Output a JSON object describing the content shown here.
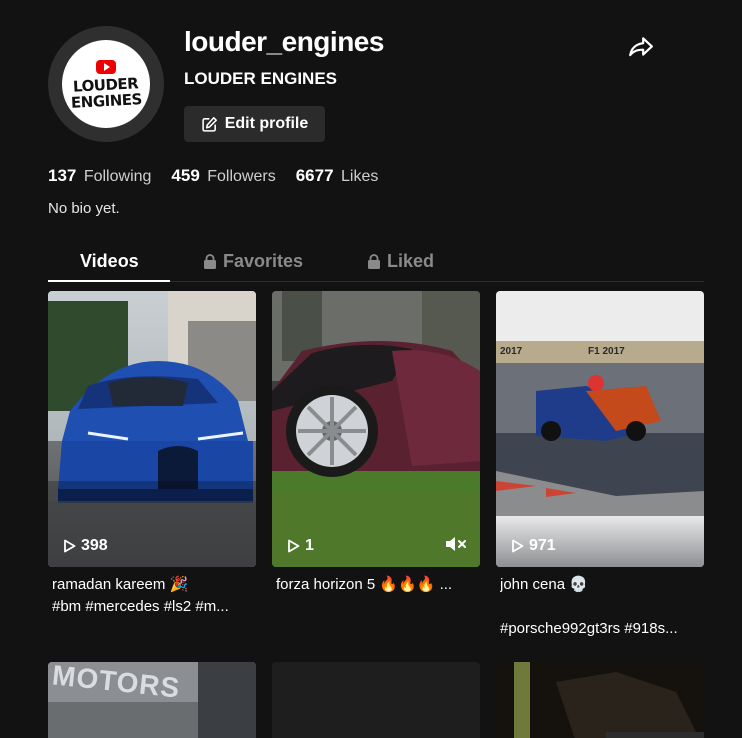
{
  "profile": {
    "username": "louder_engines",
    "nickname": "LOUDER ENGINES",
    "edit_label": "Edit profile",
    "avatar_text": [
      "LOUDER",
      "ENGINES"
    ]
  },
  "stats": {
    "following": {
      "count": "137",
      "label": "Following"
    },
    "followers": {
      "count": "459",
      "label": "Followers"
    },
    "likes": {
      "count": "6677",
      "label": "Likes"
    }
  },
  "bio": "No bio yet.",
  "tabs": [
    {
      "label": "Videos",
      "active": true,
      "locked": false
    },
    {
      "label": "Favorites",
      "active": false,
      "locked": true
    },
    {
      "label": "Liked",
      "active": false,
      "locked": true
    }
  ],
  "videos": [
    {
      "views": "398",
      "caption1": "ramadan kareem 🎉",
      "caption2": "#bm #mercedes #ls2 #m..."
    },
    {
      "views": "1",
      "caption1": "forza horizon 5 🔥🔥🔥 ...",
      "muted": true
    },
    {
      "views": "971",
      "caption1": "john cena 💀",
      "caption2": "#porsche992gt3rs #918s..."
    }
  ],
  "overlay_text": {
    "f1_left": "2017",
    "f1_right": "F1 2017",
    "motors": "MOTORS"
  },
  "icons": [
    "share-icon",
    "edit-icon",
    "lock-icon",
    "play-icon",
    "mute-icon"
  ]
}
